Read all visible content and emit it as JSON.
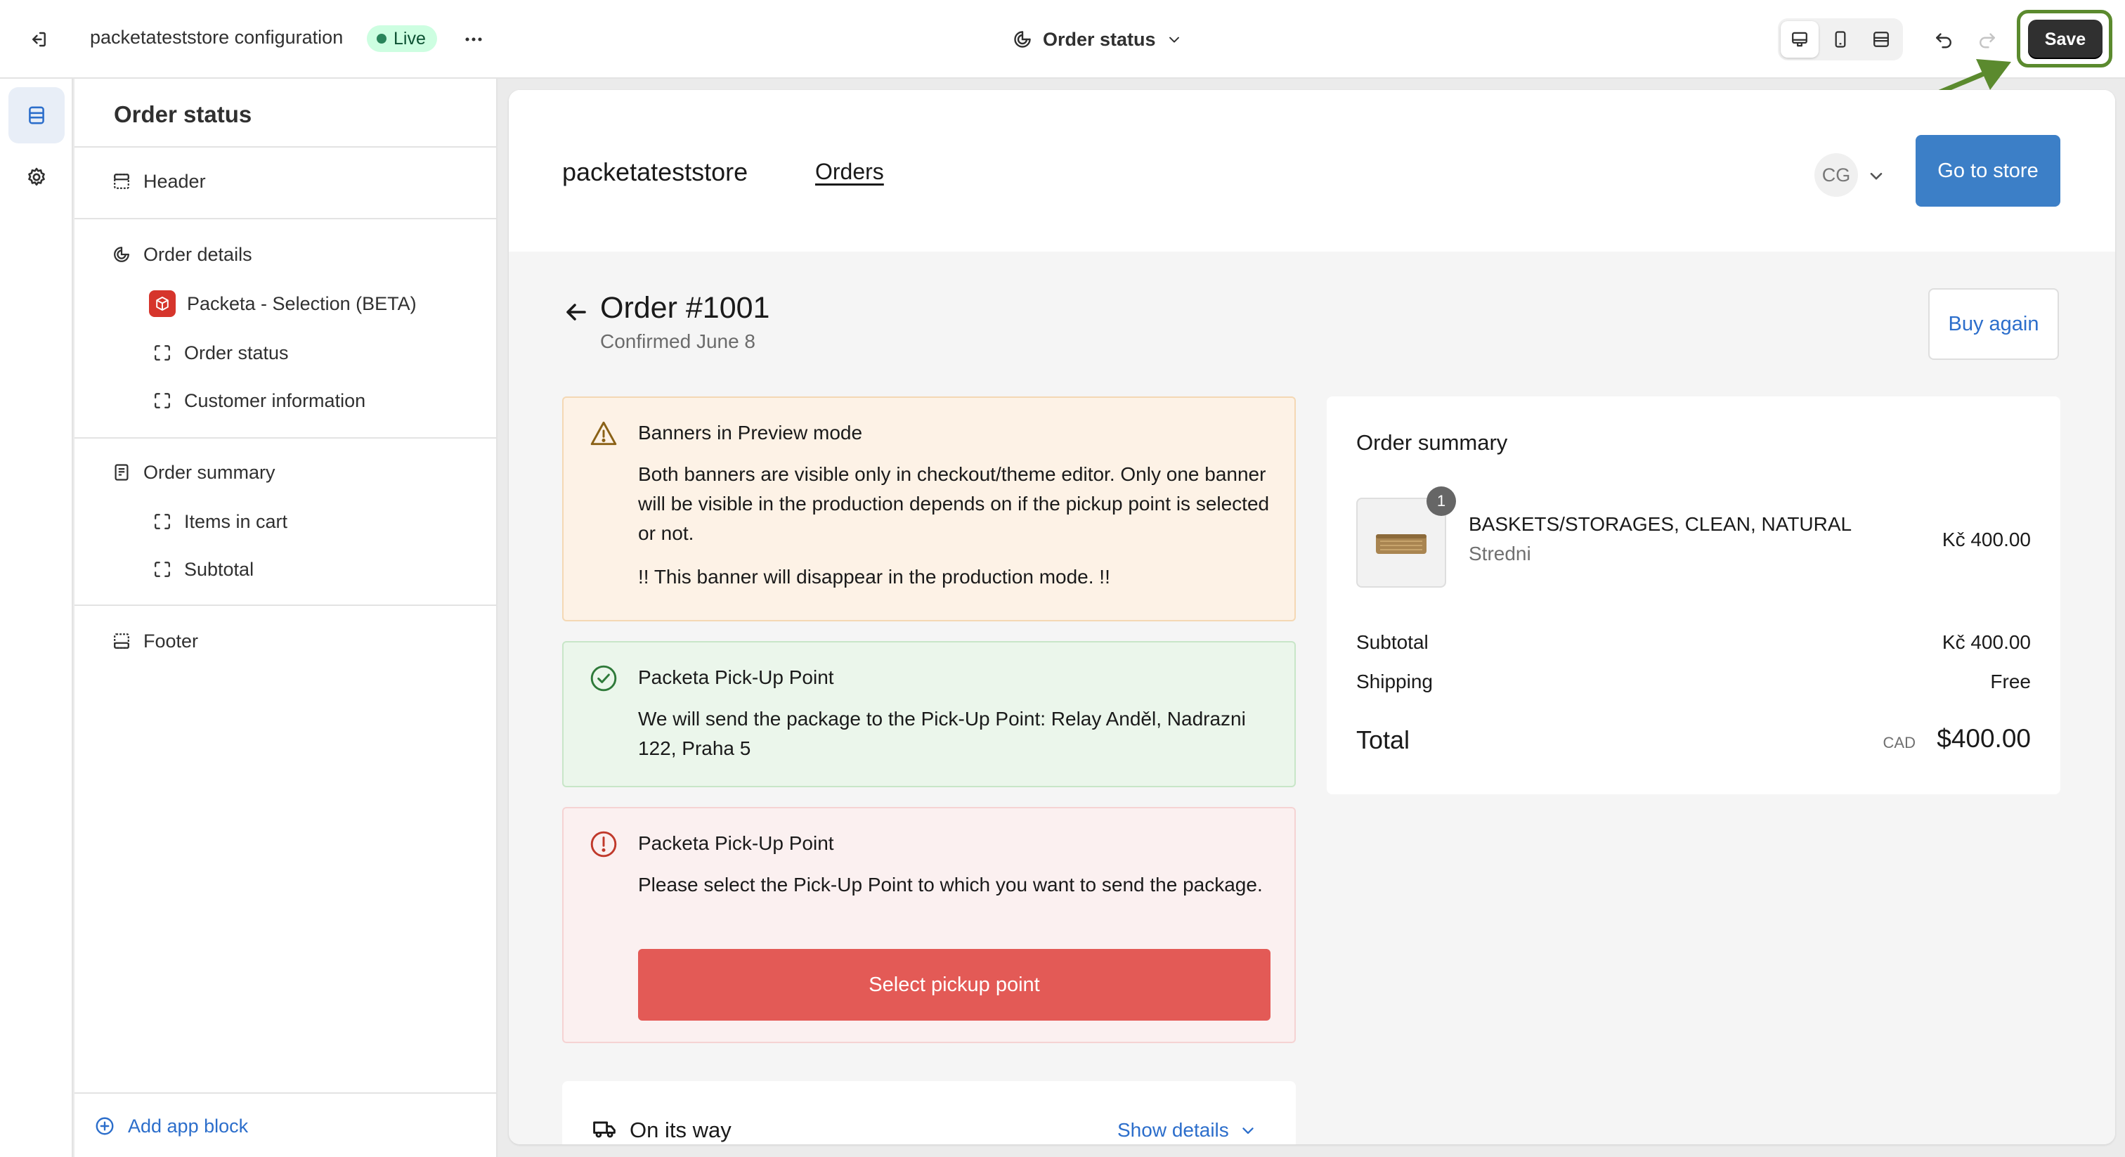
{
  "topbar": {
    "store_title": "packetateststore configuration",
    "live_badge": "Live",
    "page_select": "Order status",
    "save_label": "Save"
  },
  "sidebar": {
    "title": "Order status",
    "sections": {
      "header": "Header",
      "order_details": "Order details",
      "packeta_selection": "Packeta - Selection (BETA)",
      "order_status": "Order status",
      "customer_information": "Customer information",
      "order_summary": "Order summary",
      "items_in_cart": "Items in cart",
      "subtotal": "Subtotal",
      "footer": "Footer"
    },
    "add_app_block": "Add app block"
  },
  "preview": {
    "store_name": "packetateststore",
    "nav_orders": "Orders",
    "avatar_initials": "CG",
    "go_to_store": "Go to store",
    "order_title": "Order #1001",
    "confirmed": "Confirmed June 8",
    "buy_again": "Buy again",
    "banner_warning": {
      "title": "Banners in Preview mode",
      "text": "Both banners are visible only in checkout/theme editor. Only one banner will be visible in the production depends on if the pickup point is selected or not.",
      "note": "!! This banner will disappear in the production mode. !!"
    },
    "banner_success": {
      "title": "Packeta Pick-Up Point",
      "text": "We will send the package to the Pick-Up Point: Relay Anděl, Nadrazni 122, Praha 5"
    },
    "banner_error": {
      "title": "Packeta Pick-Up Point",
      "text": "Please select the Pick-Up Point to which you want to send the package.",
      "button": "Select pickup point"
    },
    "summary": {
      "title": "Order summary",
      "quantity": "1",
      "product_name": "BASKETS/STORAGES, CLEAN, NATURAL",
      "product_variant": "Stredni",
      "product_price": "Kč 400.00",
      "subtotal_label": "Subtotal",
      "subtotal_value": "Kč 400.00",
      "shipping_label": "Shipping",
      "shipping_value": "Free",
      "total_label": "Total",
      "total_currency": "CAD",
      "total_value": "$400.00"
    },
    "on_its_way": {
      "title": "On its way",
      "show_details": "Show details"
    }
  },
  "colors": {
    "accent": "#2c6ecb",
    "go_to_store_button": "#3c7fc7",
    "select_pickup_button": "#e35a56",
    "save_button": "#303030",
    "annotation_green": "#5b8a2e"
  },
  "icons": {
    "exit": "exit-icon",
    "more": "more-icon",
    "page": "order-status-icon",
    "desktop": "desktop-icon",
    "mobile": "mobile-icon",
    "fullscreen": "fullscreen-icon",
    "undo": "undo-icon",
    "redo": "redo-icon",
    "sections": "sections-icon",
    "settings": "gear-icon"
  }
}
